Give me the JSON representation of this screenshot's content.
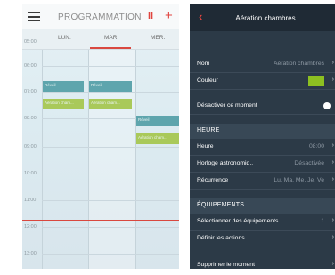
{
  "left": {
    "header": {
      "title": "PROGRAMMATION",
      "pause_icon": "pause-icon",
      "pause_glyph": "II",
      "add_glyph": "+",
      "menu_icon": "hamburger-icon"
    },
    "days": [
      "LUN.",
      "MAR.",
      "MER."
    ],
    "selected_day": "MAR.",
    "times": [
      "05:00",
      "06:00",
      "07:00",
      "08:00",
      "09:00",
      "10:00",
      "11:00",
      "12:00",
      "13:00"
    ],
    "events": [
      {
        "label": "Réveil",
        "day": "LUN."
      },
      {
        "label": "Réveil",
        "day": "MAR."
      },
      {
        "label": "Aération cham...",
        "day": "LUN."
      },
      {
        "label": "Aération cham...",
        "day": "MAR."
      },
      {
        "label": "Réveil",
        "day": "MER."
      },
      {
        "label": "Aération cham...",
        "day": "MER."
      }
    ],
    "colors": {
      "accent": "#e0443f",
      "event_teal": "#5ea5ad",
      "event_green": "#a9c95a"
    }
  },
  "right": {
    "header": {
      "back_glyph": "‹",
      "title": "Aération chambres"
    },
    "rows": {
      "nom": {
        "label": "Nom",
        "value": "Aération chambres"
      },
      "couleur": {
        "label": "Couleur",
        "color": "#8dc021"
      },
      "desactiver": {
        "label": "Désactiver ce moment"
      },
      "heure_section": "HEURE",
      "heure": {
        "label": "Heure",
        "value": "08:00"
      },
      "horloge": {
        "label": "Horloge astronomiq..",
        "value": "Désactivée"
      },
      "recurrence": {
        "label": "Récurrence",
        "value": "Lu, Ma, Me, Je, Ve"
      },
      "equipements_section": "ÉQUIPEMENTS",
      "selectionner": {
        "label": "Sélectionner des équipements",
        "value": "1"
      },
      "definir": {
        "label": "Définir les actions"
      },
      "supprimer": {
        "label": "Supprimer le moment"
      }
    },
    "chevron_glyph": "›"
  }
}
